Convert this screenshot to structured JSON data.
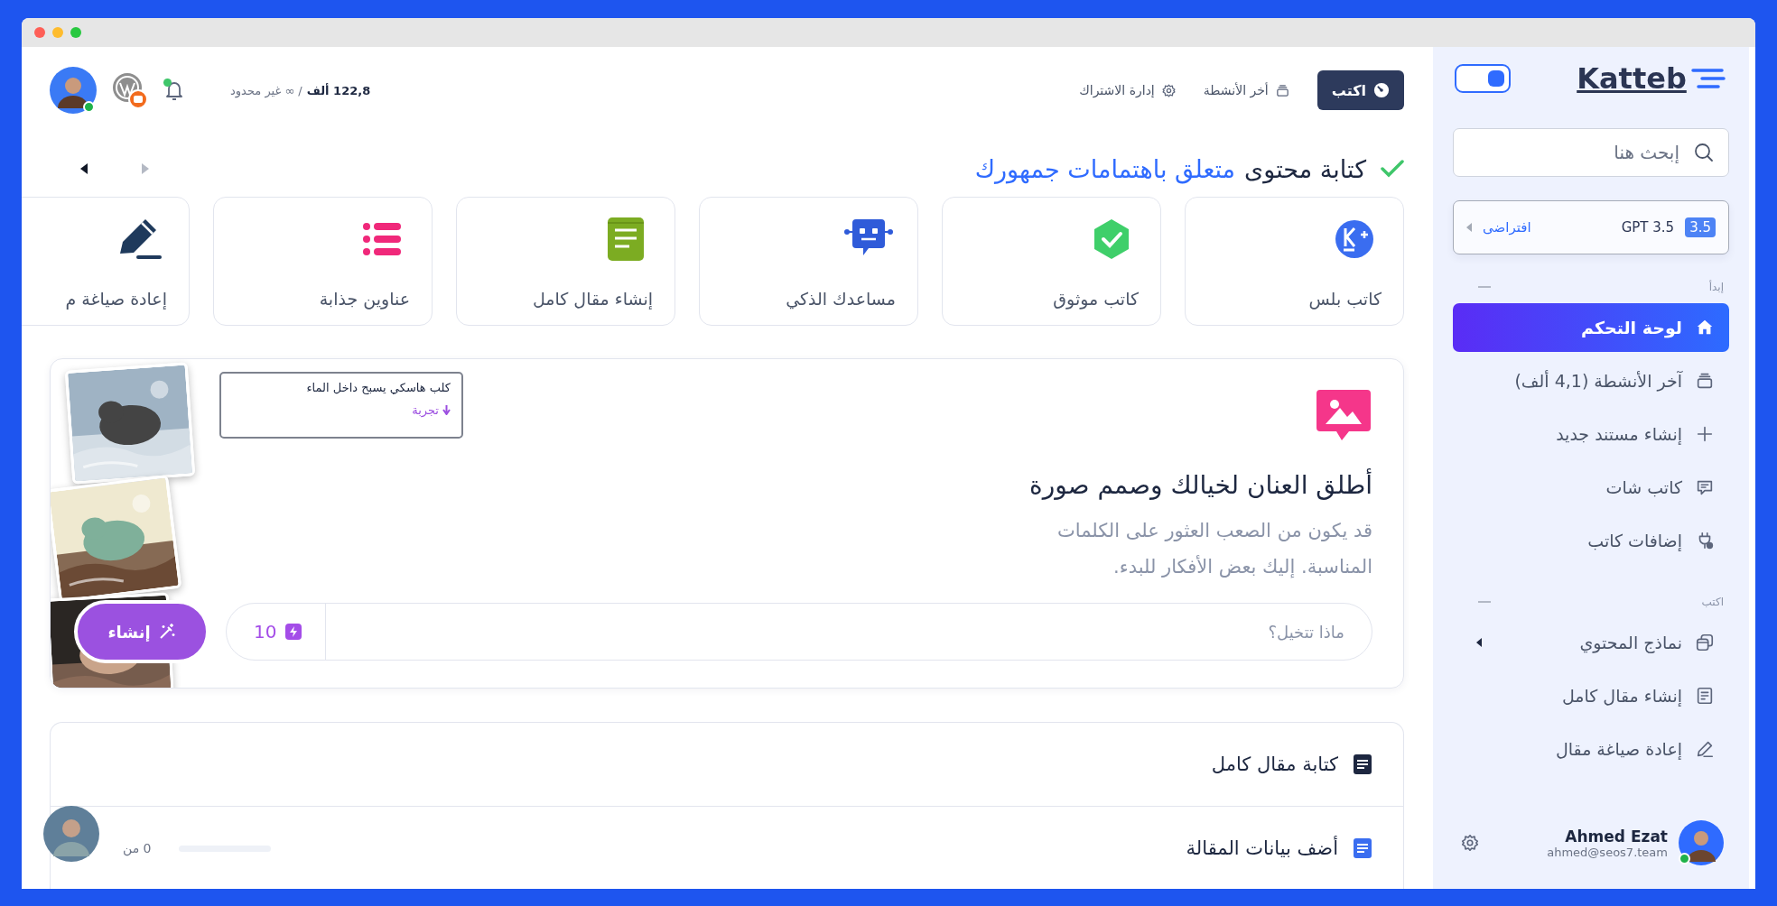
{
  "header": {
    "write_button": "اكتب",
    "links": [
      {
        "label": "أخر الأنشطة",
        "kind": "activity"
      },
      {
        "label": "إدارة الاشتراك",
        "kind": "settings"
      }
    ],
    "usage": "122,8 ألف",
    "limit": "/ ∞ غير محدود",
    "notifications": {
      "unread": true
    },
    "user": {
      "online": true
    }
  },
  "heading": {
    "lead": "كتابة محتوى",
    "highlight": "متعلق باهتمامات جمهورك"
  },
  "tools": [
    {
      "label": "كاتب بلس",
      "kind": "k-plus"
    },
    {
      "label": "كاتب موثوق",
      "kind": "verified"
    },
    {
      "label": "مساعدك الذكي",
      "kind": "robot"
    },
    {
      "label": "إنشاء مقال كامل",
      "kind": "document"
    },
    {
      "label": "عناوين جذابة",
      "kind": "list"
    },
    {
      "label": "إعادة صياغة م",
      "kind": "pencil"
    }
  ],
  "image_generator": {
    "title": "أطلق العنان لخيالك وصمم صورة",
    "description": "قد يكون من الصعب العثور على الكلمات المناسبة. إليك بعض الأفكار للبدء.",
    "prompt": {
      "placeholder": "ماذا تتخيل؟"
    },
    "credits": "10",
    "button": "إنشاء",
    "example": {
      "caption": "كلب هاسكي يسبح داخل الماء",
      "action": "تجربة"
    }
  },
  "article": {
    "title": "كتابة مقال كامل",
    "steps": [
      {
        "label": "أضف بيانات المقالة",
        "progress": "0 من",
        "level": 0
      }
    ]
  },
  "sidebar": {
    "logo": "Katteb",
    "theme_toggle": {
      "on": true
    },
    "search": {
      "placeholder": "إبحث هنا"
    },
    "model": {
      "badge": "3.5",
      "name": "GPT 3.5",
      "mode": "افتراضى"
    },
    "sections": [
      {
        "title": "إبدأ",
        "items": [
          {
            "label": "لوحة التحكم",
            "selected": true,
            "submenu": false
          },
          {
            "label": "آخر الأنشطة (4,1 ألف)",
            "selected": false,
            "submenu": false
          },
          {
            "label": "إنشاء مستند جديد",
            "selected": false,
            "submenu": false
          },
          {
            "label": "كاتب شات",
            "selected": false,
            "submenu": false
          },
          {
            "label": "إضافات كاتب",
            "selected": false,
            "submenu": false
          }
        ]
      },
      {
        "title": "اكتب",
        "items": [
          {
            "label": "نماذج المحتوي",
            "selected": false,
            "submenu": true
          },
          {
            "label": "إنشاء مقال كامل",
            "selected": false,
            "submenu": false
          },
          {
            "label": "إعادة صياغة مقال",
            "selected": false,
            "submenu": false
          }
        ]
      }
    ],
    "user": {
      "name": "Ahmed Ezat",
      "email": "ahmed@seos7.team",
      "online": true
    }
  }
}
